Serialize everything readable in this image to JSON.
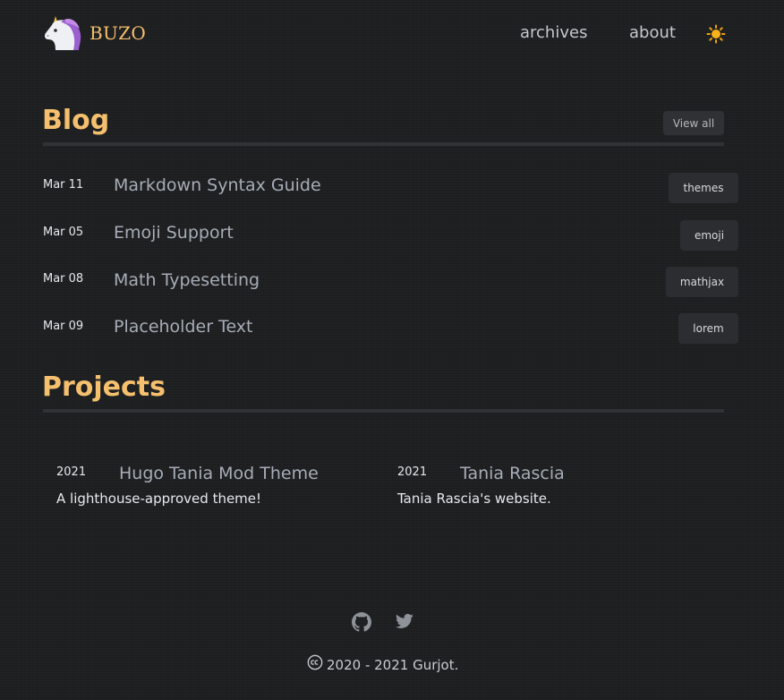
{
  "header": {
    "logo_text": "BUZO",
    "nav": [
      {
        "label": "archives"
      },
      {
        "label": "about"
      }
    ],
    "theme_toggle_icon": "sun-icon"
  },
  "blog": {
    "heading": "Blog",
    "view_all_label": "View all",
    "posts": [
      {
        "date": "Mar 11",
        "title": "Markdown Syntax Guide",
        "tag": "themes"
      },
      {
        "date": "Mar 05",
        "title": "Emoji Support",
        "tag": "emoji"
      },
      {
        "date": "Mar 08",
        "title": "Math Typesetting",
        "tag": "mathjax"
      },
      {
        "date": "Mar 09",
        "title": "Placeholder Text",
        "tag": "lorem"
      }
    ]
  },
  "projects": {
    "heading": "Projects",
    "items": [
      {
        "year": "2021",
        "title": "Hugo Tania Mod Theme",
        "description": "A lighthouse-approved theme!"
      },
      {
        "year": "2021",
        "title": "Tania Rascia",
        "description": "Tania Rascia's website."
      }
    ]
  },
  "footer": {
    "social_icons": [
      "github-icon",
      "twitter-icon"
    ],
    "copyright_text": "2020 - 2021 Gurjot."
  },
  "colors": {
    "background": "#1e1f21",
    "accent": "#f5c06e",
    "link": "#a6adb7",
    "text": "#e6e8eb"
  }
}
